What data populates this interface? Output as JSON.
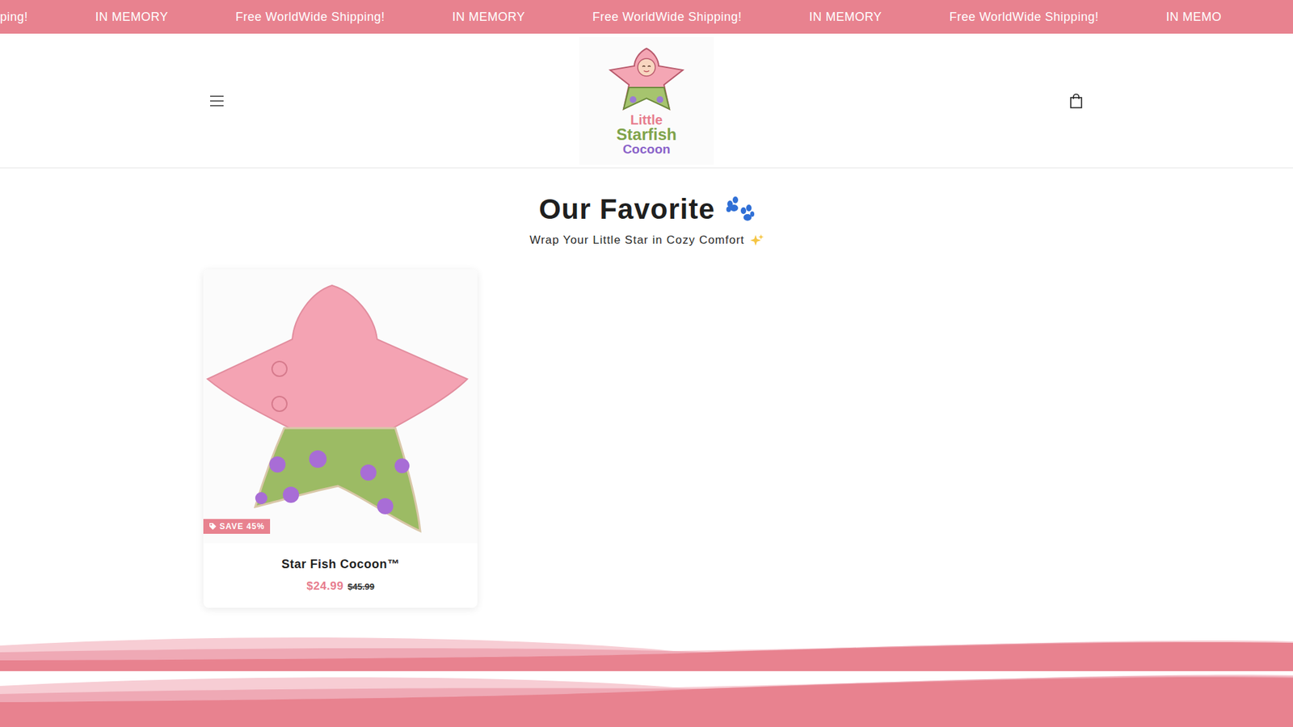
{
  "announcement": {
    "items": [
      "ping!",
      "IN MEMORY",
      "Free WorldWide Shipping!",
      "IN MEMORY",
      "Free WorldWide Shipping!",
      "IN MEMORY",
      "Free WorldWide Shipping!",
      "IN MEMO"
    ]
  },
  "header": {
    "logo": {
      "lines": [
        "Little",
        "Starfish",
        "Cocoon"
      ]
    }
  },
  "section": {
    "title": "Our Favorite",
    "subtitle": "Wrap Your Little Star in Cozy Comfort"
  },
  "products": [
    {
      "name": "Star Fish Cocoon™",
      "price": "$24.99",
      "compare_price": "$45.99",
      "badge": "SAVE 45%"
    }
  ]
}
